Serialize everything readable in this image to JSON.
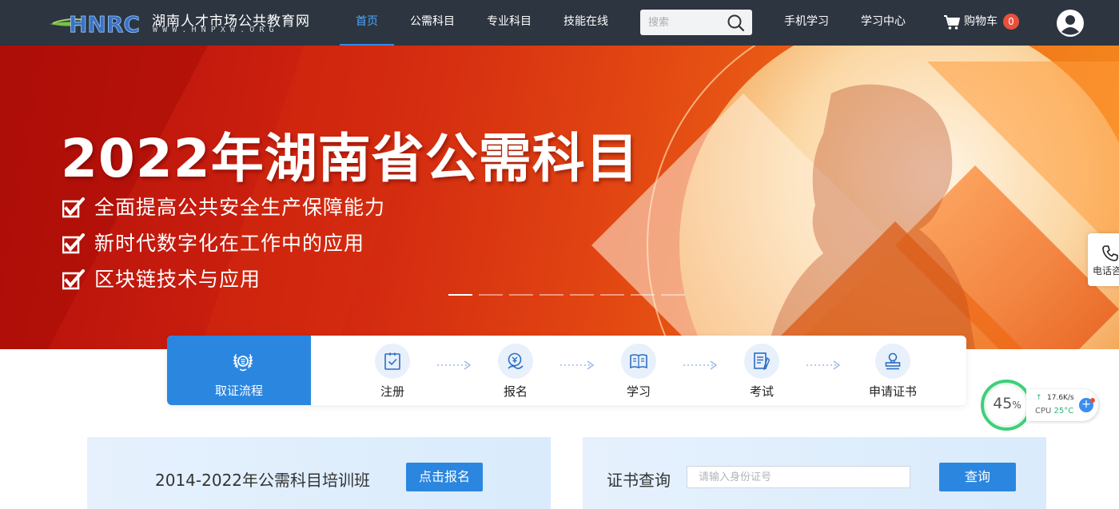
{
  "header": {
    "logo": {
      "mark_text": "HNRC",
      "title": "湖南人才市场公共教育网",
      "subtitle": "WWW.HNPXW.ORG"
    },
    "nav": [
      {
        "label": "首页",
        "active": true
      },
      {
        "label": "公需科目",
        "active": false
      },
      {
        "label": "专业科目",
        "active": false
      },
      {
        "label": "技能在线",
        "active": false
      }
    ],
    "search": {
      "placeholder": "搜索",
      "value": ""
    },
    "right_nav": [
      {
        "label": "手机学习"
      },
      {
        "label": "学习中心"
      }
    ],
    "cart": {
      "label": "购物车",
      "count": "0"
    }
  },
  "banner": {
    "title": "2022年湖南省公需科目",
    "bullets": [
      "全面提高公共安全生产保障能力",
      "新时代数字化在工作中的应用",
      "区块链技术与应用"
    ],
    "slide_count": 8,
    "active_slide": 0
  },
  "side_float": {
    "label": "电话咨询"
  },
  "process": {
    "head_label": "取证流程",
    "steps": [
      {
        "label": "注册",
        "icon": "clipboard-check-icon"
      },
      {
        "label": "报名",
        "icon": "signup-icon"
      },
      {
        "label": "学习",
        "icon": "book-icon"
      },
      {
        "label": "考试",
        "icon": "exam-icon"
      },
      {
        "label": "申请证书",
        "icon": "certificate-stamp-icon"
      }
    ]
  },
  "cards": {
    "training": {
      "title": "2014-2022年公需科目培训班",
      "button": "点击报名"
    },
    "certificate": {
      "title": "证书查询",
      "input_placeholder": "请输入身份证号",
      "input_value": "",
      "button": "查询"
    }
  },
  "monitor": {
    "percent": "45",
    "percent_unit": "%",
    "net_speed": "17.6K/s",
    "cpu_label": "CPU",
    "cpu_temp": "25°C",
    "plus": "+"
  },
  "colors": {
    "header_bg": "#2d3540",
    "accent": "#2b86e0",
    "nav_active": "#4aa8ff",
    "badge": "#e9503c",
    "banner_red": "#c21a0d",
    "banner_orange": "#f48a1e"
  }
}
